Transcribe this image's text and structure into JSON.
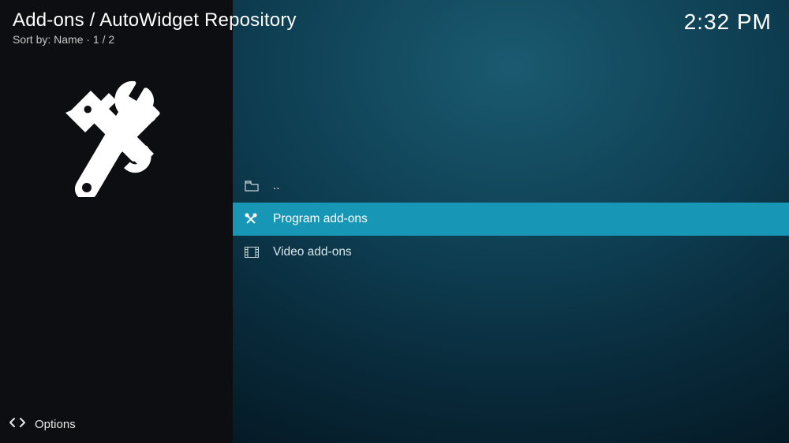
{
  "header": {
    "breadcrumb": "Add-ons / AutoWidget Repository",
    "sort_label": "Sort by: Name  ·  1 / 2"
  },
  "clock": "2:32 PM",
  "list": {
    "items": [
      {
        "icon": "folder-up-icon",
        "label": "..",
        "selected": false
      },
      {
        "icon": "tools-icon",
        "label": "Program add-ons",
        "selected": true
      },
      {
        "icon": "video-icon",
        "label": "Video add-ons",
        "selected": false
      }
    ]
  },
  "footer": {
    "options_label": "Options"
  }
}
